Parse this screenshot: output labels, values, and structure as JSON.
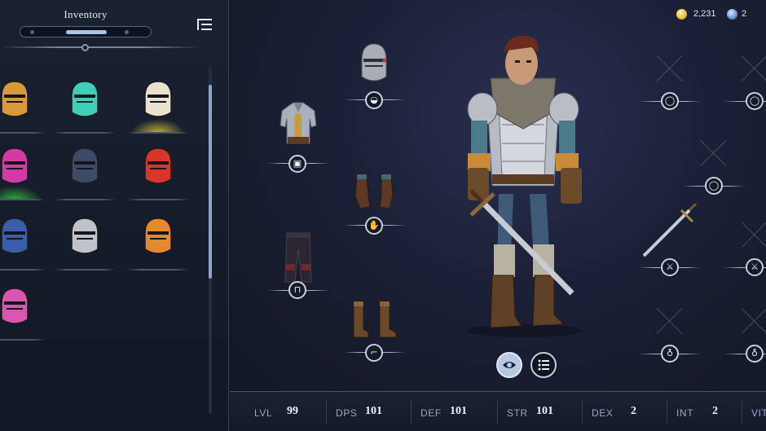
{
  "inventory": {
    "title": "Inventory",
    "items": [
      {
        "name": "gold-helmet",
        "color": "#d79a35",
        "glow": ""
      },
      {
        "name": "teal-helmet",
        "color": "#3fd0b8",
        "glow": ""
      },
      {
        "name": "ivory-helmet",
        "color": "#e8e2cf",
        "glow": "#c8b53a"
      },
      {
        "name": "magenta-helmet",
        "color": "#d23aa8",
        "glow": "#2fb43a"
      },
      {
        "name": "dark-steel-helmet",
        "color": "#3c4a66",
        "glow": ""
      },
      {
        "name": "red-helmet",
        "color": "#d8362a",
        "glow": ""
      },
      {
        "name": "blue-gold-helmet",
        "color": "#3a5fa8",
        "glow": ""
      },
      {
        "name": "silver-helmet",
        "color": "#bfc3c9",
        "glow": ""
      },
      {
        "name": "orange-helmet",
        "color": "#e58a2c",
        "glow": ""
      },
      {
        "name": "pink-helmet",
        "color": "#d855b0",
        "glow": ""
      }
    ]
  },
  "currency": {
    "gold": "2,231",
    "gems": "2"
  },
  "equipment": {
    "left_column": [
      {
        "name": "chest-armor-slot",
        "icon": "chest-icon"
      },
      {
        "name": "legs-slot",
        "icon": "pants-icon"
      }
    ],
    "center_column": [
      {
        "name": "helmet-slot",
        "icon": "helmet-icon"
      },
      {
        "name": "gloves-slot",
        "icon": "glove-icon"
      },
      {
        "name": "boots-slot",
        "icon": "boot-icon"
      }
    ],
    "right_columns": [
      {
        "name": "ring-slot-1",
        "icon": "ring-icon"
      },
      {
        "name": "ring-slot-2",
        "icon": "ring-icon"
      },
      {
        "name": "amulet-slot",
        "icon": "ring-icon"
      },
      {
        "name": "weapon-slot-1",
        "icon": "sword-icon"
      },
      {
        "name": "weapon-slot-2",
        "icon": "sword-icon"
      },
      {
        "name": "potion-slot-1",
        "icon": "potion-icon"
      },
      {
        "name": "potion-slot-2",
        "icon": "potion-icon"
      }
    ]
  },
  "stats": [
    {
      "key": "LVL",
      "value": "99"
    },
    {
      "key": "DPS",
      "value": "101"
    },
    {
      "key": "DEF",
      "value": "101"
    },
    {
      "key": "STR",
      "value": "101"
    },
    {
      "key": "DEX",
      "value": "2"
    },
    {
      "key": "INT",
      "value": "2"
    },
    {
      "key": "VIT",
      "value": ""
    }
  ],
  "colors": {
    "accent": "#a9c3e0",
    "panel_bg": "#141b29",
    "stat_label": "#93a7c7"
  }
}
